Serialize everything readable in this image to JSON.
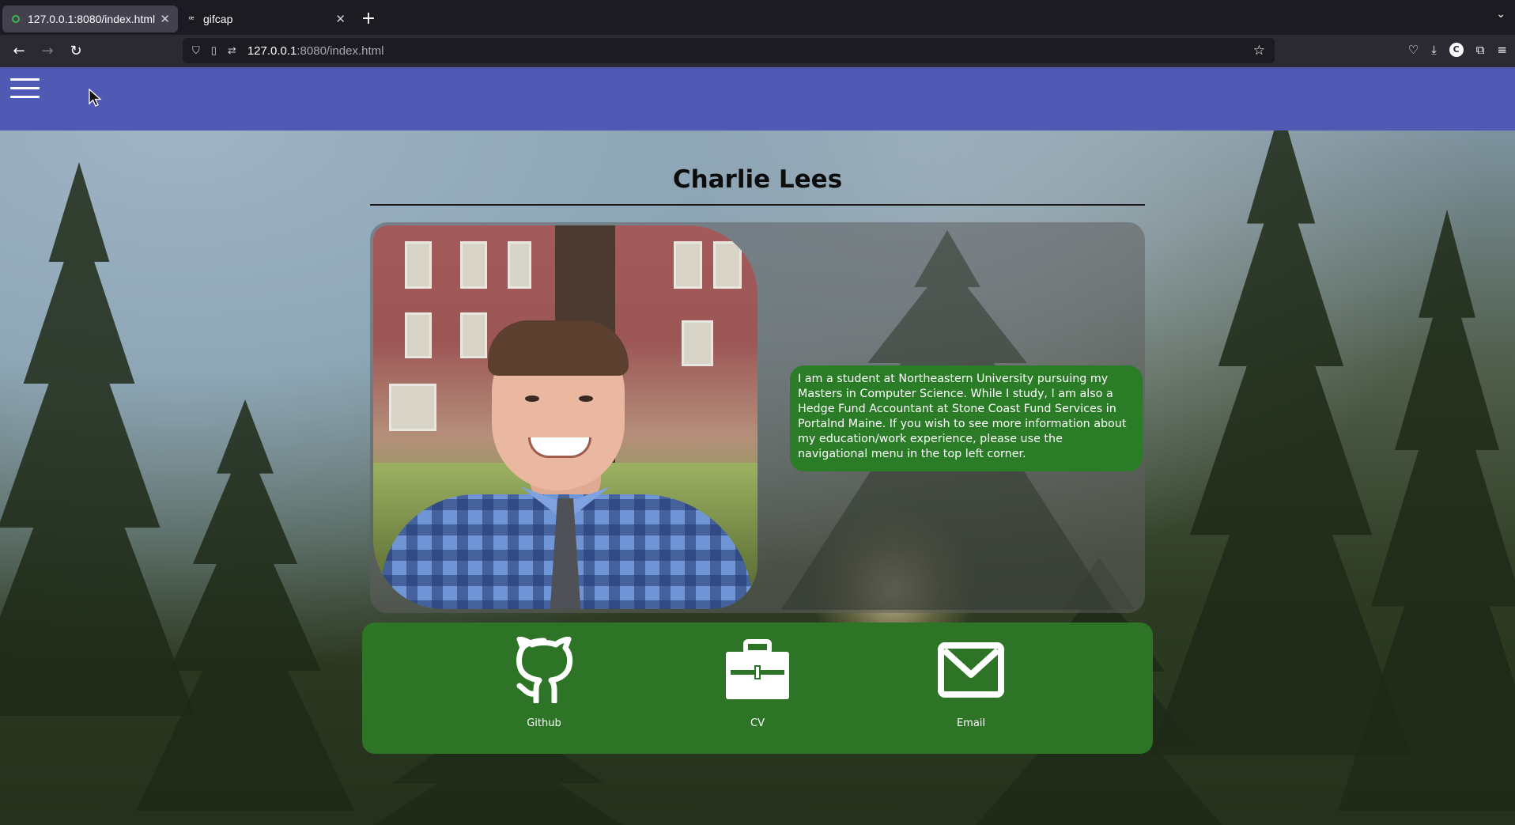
{
  "browser": {
    "tabs": [
      {
        "title": "127.0.0.1:8080/index.html",
        "active": true
      },
      {
        "title": "gifcap",
        "active": false
      }
    ],
    "url_host": "127.0.0.1",
    "url_rest": ":8080/index.html",
    "account_initial": "C"
  },
  "page": {
    "name": "Charlie Lees",
    "bio": "I am a student at Northeastern University pursuing my Masters in Computer Science. While I study, I am also a Hedge Fund Accountant at Stone Coast Fund Services in Portalnd Maine. If you wish to see more information about my education/work experience, please use the navigational menu in the top left corner.",
    "links": [
      {
        "label": "Github",
        "icon": "github-icon"
      },
      {
        "label": "CV",
        "icon": "briefcase-icon"
      },
      {
        "label": "Email",
        "icon": "envelope-icon"
      }
    ]
  },
  "colors": {
    "nav_bar": "#5059b3",
    "bio_bubble": "#2b7c27",
    "links_panel": "#2d7427"
  }
}
